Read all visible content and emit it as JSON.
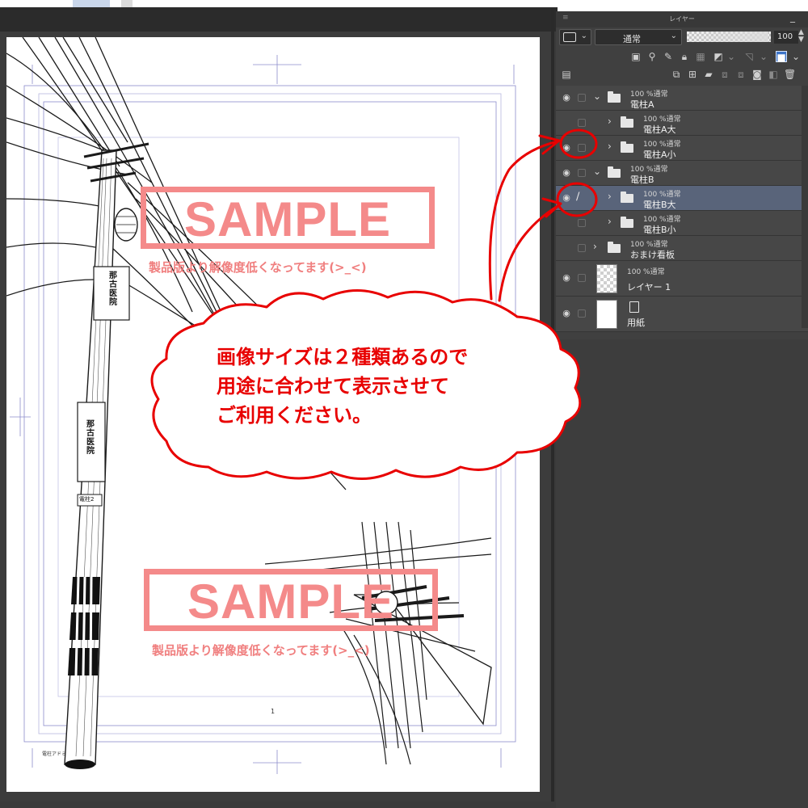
{
  "panel": {
    "title": "レイヤー",
    "blend_mode": "通常",
    "opacity_value": "100",
    "opacity_fraction": 0.97
  },
  "layers": [
    {
      "meta": "100 %通常",
      "name": "電柱A"
    },
    {
      "meta": "100 %通常",
      "name": "電柱A大"
    },
    {
      "meta": "100 %通常",
      "name": "電柱A小"
    },
    {
      "meta": "100 %通常",
      "name": "電柱B"
    },
    {
      "meta": "100 %通常",
      "name": "電柱B大"
    },
    {
      "meta": "100 %通常",
      "name": "電柱B小"
    },
    {
      "meta": "100 %通常",
      "name": "おまけ看板"
    },
    {
      "meta": "100 %通常",
      "name": "レイヤー 1"
    },
    {
      "meta": "",
      "name": "用紙"
    }
  ],
  "canvas": {
    "watermark_word": "SAMPLE",
    "watermark_note": "製品版より解像度低くなってます(>_<)",
    "page_number": "1",
    "credit": "電柱アドミ",
    "sign_top": "那古医院",
    "sign_bottom": "那古医院",
    "sign_bottom_plate": "電柱2"
  },
  "callout": {
    "line1": "画像サイズは２種類あるので",
    "line2": "用途に合わせて表示させて",
    "line3": "ご利用ください。"
  },
  "colors": {
    "panel_bg": "#404040",
    "selected_row": "#59647a",
    "watermark": "#f48a8a",
    "annotation_red": "#e80000"
  },
  "icons": {
    "eye": "eye-icon",
    "folder": "folder-icon",
    "pen": "pen-icon",
    "expand": "chevron-right-icon",
    "collapse": "chevron-down-icon"
  }
}
